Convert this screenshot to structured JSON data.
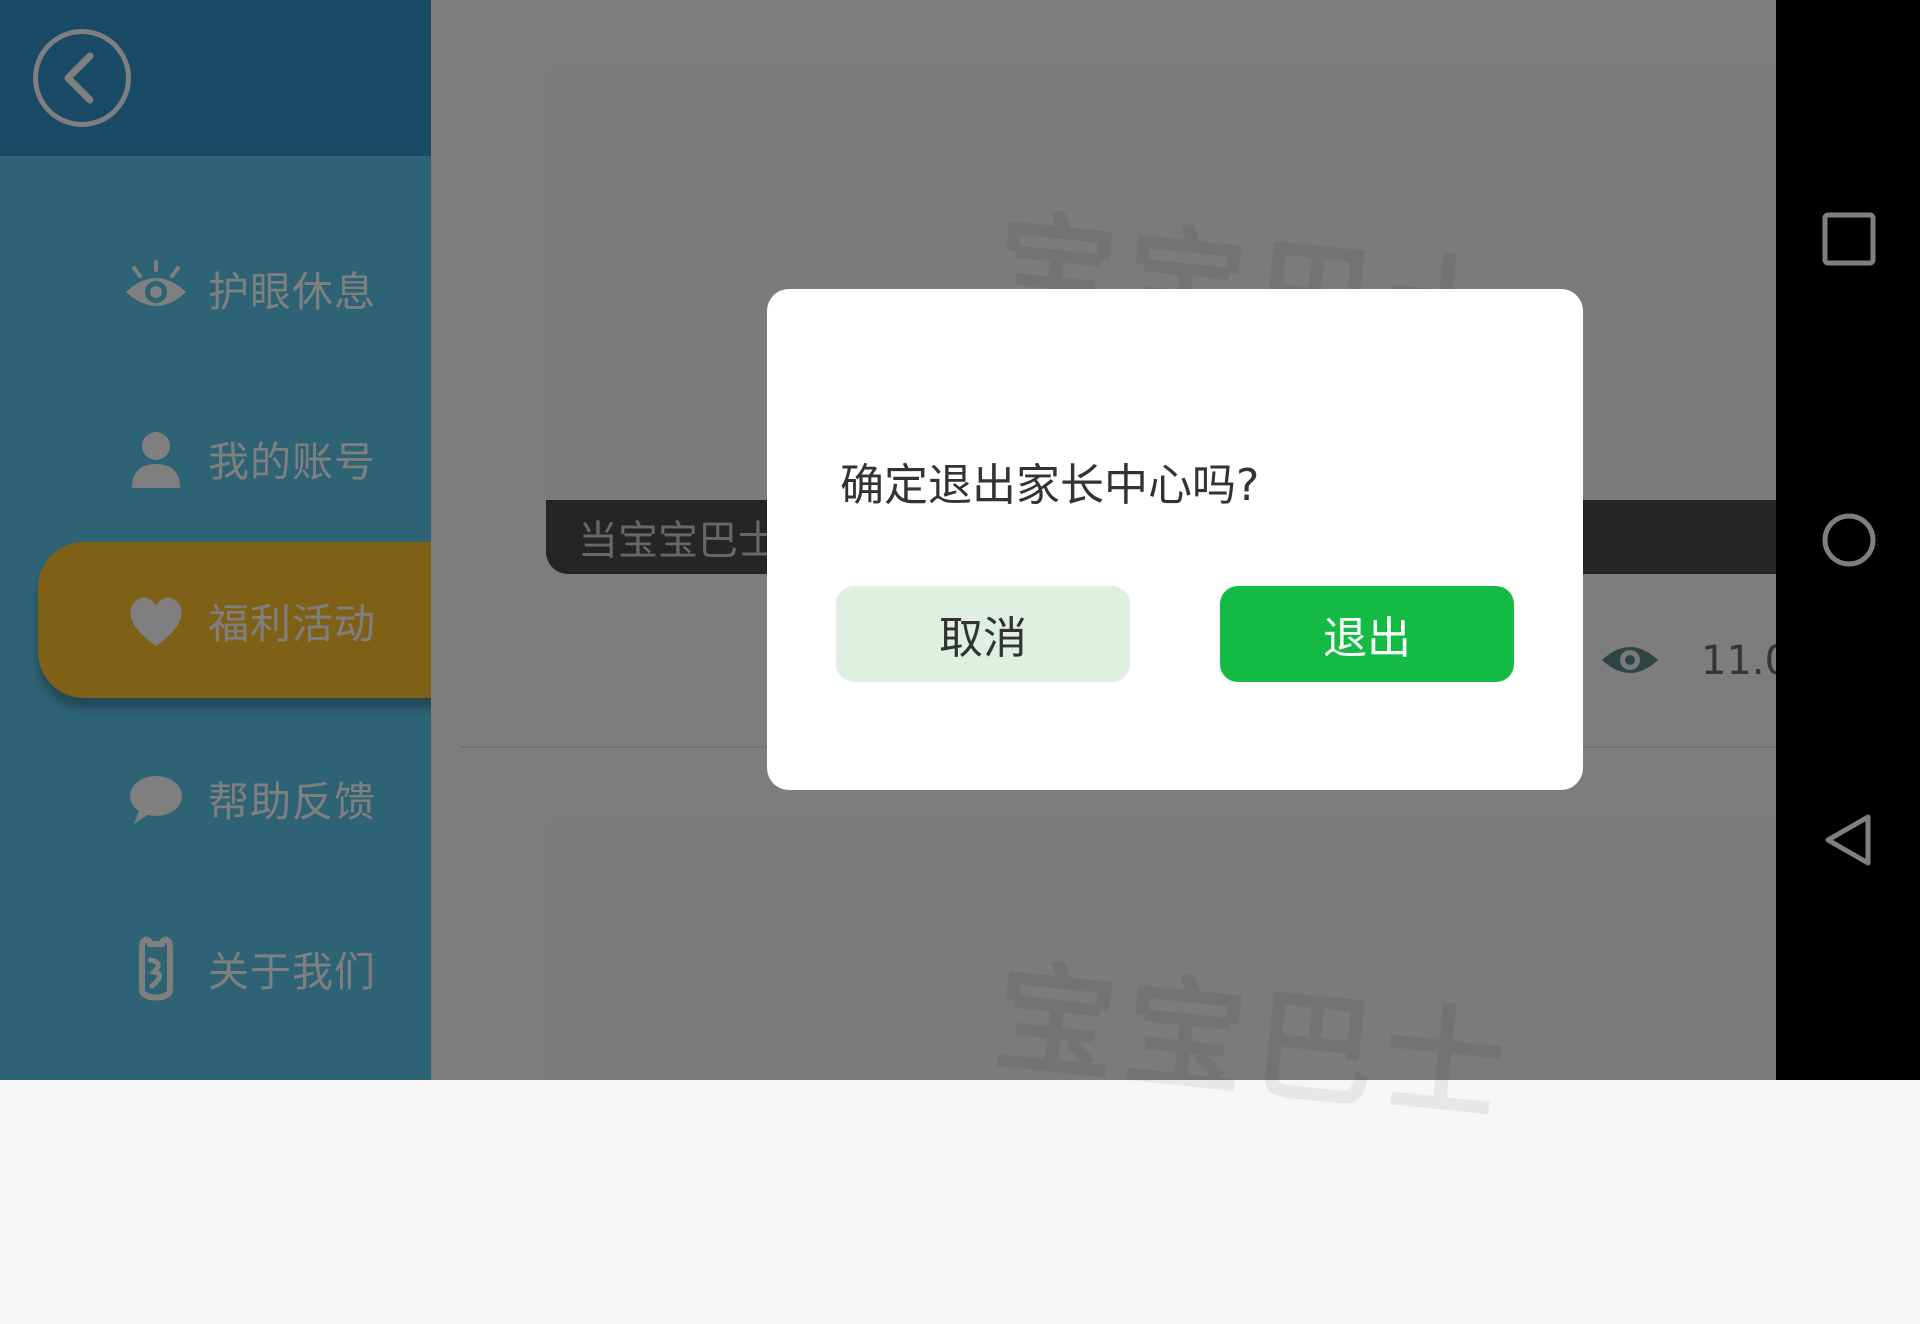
{
  "sidebar": {
    "back_icon": "back-arrow-circle-icon",
    "items": [
      {
        "label": "护眼休息",
        "icon": "eye-icon",
        "active": false
      },
      {
        "label": "我的账号",
        "icon": "user-icon",
        "active": false
      },
      {
        "label": "福利活动",
        "icon": "heart-icon",
        "active": true
      },
      {
        "label": "帮助反馈",
        "icon": "chat-bubble-icon",
        "active": false
      },
      {
        "label": "关于我们",
        "icon": "bus-logo-icon",
        "active": false
      }
    ]
  },
  "content": {
    "card_watermark": "宝宝巴士",
    "card_caption": "当宝宝巴士",
    "views_count": "11.0w"
  },
  "dialog": {
    "message": "确定退出家长中心吗?",
    "cancel_label": "取消",
    "exit_label": "退出"
  },
  "colors": {
    "sidebar_bg": "#5cc4ea",
    "sidebar_top": "#3396cc",
    "active_item": "#ffc12f",
    "exit_button": "#13bb45",
    "cancel_button": "#dff0e3"
  },
  "system_nav": {
    "icons": [
      "recents-square-icon",
      "home-circle-icon",
      "back-triangle-icon"
    ]
  }
}
